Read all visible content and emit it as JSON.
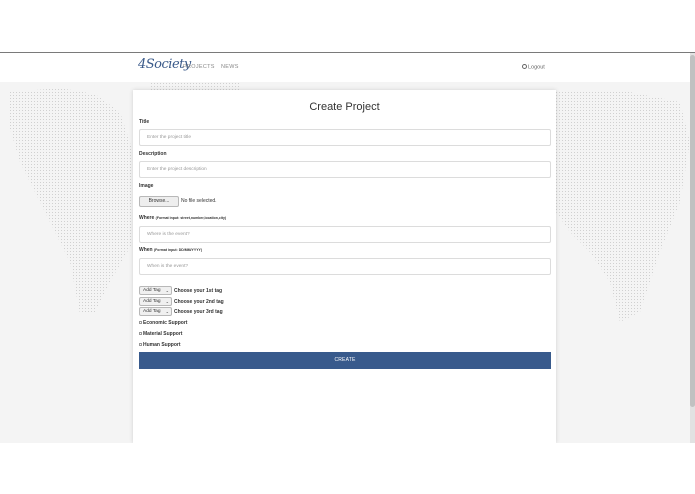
{
  "nav": {
    "logo": "4Society",
    "projects": "PROJECTS",
    "news": "NEWS",
    "logout": "Logout"
  },
  "form": {
    "title": "Create Project",
    "title_label": "Title",
    "title_placeholder": "Enter the project title",
    "description_label": "Description",
    "description_placeholder": "Enter the project description",
    "image_label": "Image",
    "browse_label": "Browse...",
    "no_file": "No file selected.",
    "where_label": "Where",
    "where_hint": "(Format input: street,number,location,city)",
    "where_placeholder": "Where is the event?",
    "when_label": "When",
    "when_hint": "(Format input: DD/MM/YYYY)",
    "when_placeholder": "When is the event?",
    "tags": [
      {
        "select": "Add Tag",
        "label": "Choose your 1st tag"
      },
      {
        "select": "Add Tag",
        "label": "Choose your 2nd tag"
      },
      {
        "select": "Add Tag",
        "label": "Choose your 3rd tag"
      }
    ],
    "supports": [
      "Economic Support",
      "Material Support",
      "Human Support"
    ],
    "create_label": "CREATE"
  },
  "colors": {
    "primary": "#385a8c",
    "background": "#f4f4f4"
  }
}
